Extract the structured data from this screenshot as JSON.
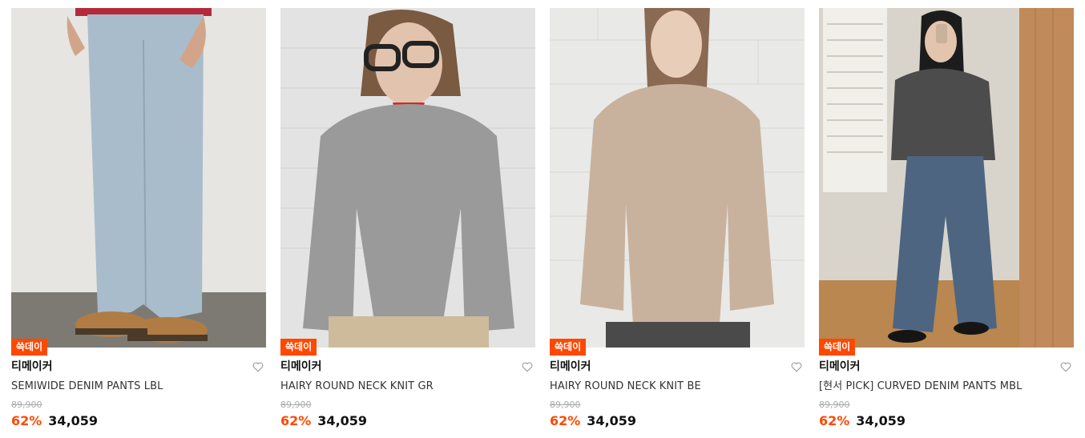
{
  "colors": {
    "accent": "#ff4800",
    "badge_text": "#ffffff",
    "strike": "#aaaaaa"
  },
  "products": [
    {
      "badge": "쓱데이",
      "brand": "티메이커",
      "name": "SEMIWIDE DENIM PANTS LBL",
      "original_price": "89,900",
      "discount": "62%",
      "price": "34,059",
      "wishlist_icon": "heart-outline-icon"
    },
    {
      "badge": "쓱데이",
      "brand": "티메이커",
      "name": "HAIRY ROUND NECK KNIT GR",
      "original_price": "89,900",
      "discount": "62%",
      "price": "34,059",
      "wishlist_icon": "heart-outline-icon"
    },
    {
      "badge": "쓱데이",
      "brand": "티메이커",
      "name": "HAIRY ROUND NECK KNIT BE",
      "original_price": "89,900",
      "discount": "62%",
      "price": "34,059",
      "wishlist_icon": "heart-outline-icon"
    },
    {
      "badge": "쓱데이",
      "brand": "티메이커",
      "name": "[현서 PICK] CURVED DENIM PANTS MBL",
      "original_price": "89,900",
      "discount": "62%",
      "price": "34,059",
      "wishlist_icon": "heart-outline-icon"
    }
  ]
}
